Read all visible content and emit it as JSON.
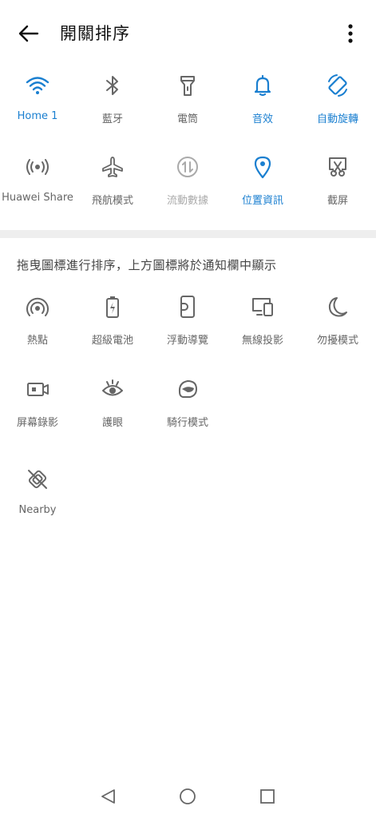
{
  "header": {
    "title": "開關排序"
  },
  "active_section": {
    "tiles": [
      {
        "label": "Home 1",
        "icon": "wifi-icon",
        "state": "active"
      },
      {
        "label": "藍牙",
        "icon": "bluetooth-icon",
        "state": "inactive"
      },
      {
        "label": "電筒",
        "icon": "flashlight-icon",
        "state": "inactive"
      },
      {
        "label": "音效",
        "icon": "bell-icon",
        "state": "active"
      },
      {
        "label": "自動旋轉",
        "icon": "auto-rotate-icon",
        "state": "active"
      },
      {
        "label": "Huawei Share",
        "icon": "huawei-share-icon",
        "state": "inactive"
      },
      {
        "label": "飛航模式",
        "icon": "airplane-icon",
        "state": "inactive"
      },
      {
        "label": "流動數據",
        "icon": "mobile-data-icon",
        "state": "disabled"
      },
      {
        "label": "位置資訊",
        "icon": "location-icon",
        "state": "active"
      },
      {
        "label": "截屏",
        "icon": "screenshot-icon",
        "state": "inactive"
      }
    ]
  },
  "hint": "拖曳圖標進行排序，上方圖標將於通知欄中顯示",
  "inactive_section": {
    "tiles": [
      {
        "label": "熱點",
        "icon": "hotspot-icon"
      },
      {
        "label": "超級電池",
        "icon": "battery-icon"
      },
      {
        "label": "浮動導覽",
        "icon": "floating-dock-icon"
      },
      {
        "label": "無線投影",
        "icon": "wireless-projection-icon"
      },
      {
        "label": "勿擾模式",
        "icon": "moon-icon"
      },
      {
        "label": "屏幕錄影",
        "icon": "screen-record-icon"
      },
      {
        "label": "護眼",
        "icon": "eye-icon"
      },
      {
        "label": "騎行模式",
        "icon": "ride-mode-icon"
      },
      {
        "label": "Nearby",
        "icon": "nearby-icon"
      }
    ]
  },
  "colors": {
    "accent": "#1a7fd0",
    "icon_gray": "#666666",
    "disabled_gray": "#aaaaaa",
    "band": "#eeeeee"
  }
}
